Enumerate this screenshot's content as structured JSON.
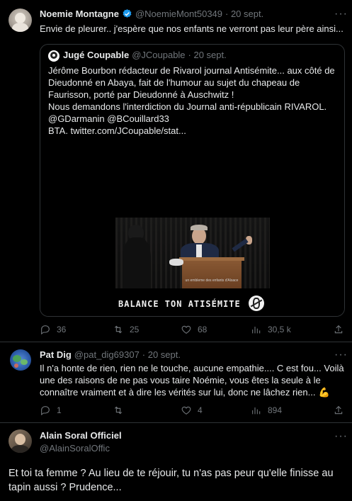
{
  "tweet1": {
    "name": "Noemie Montagne",
    "handle": "@NoemieMont50349",
    "date": "· 20 sept.",
    "text": "Envie de pleurer.. j'espère que nos enfants ne verront pas leur père ainsi...",
    "quote": {
      "name": "Jugé Coupable",
      "handle": "@JCoupable",
      "date": "· 20 sept.",
      "lines": [
        "Jérôme Bourbon rédacteur de Rivarol journal Antisémite... aux côté de",
        "Dieudonné en Abaya, fait de l'humour au sujet du chapeau de",
        "Faurisson, porté par Dieudonné à Auschwitz !",
        "Nous demandons l'interdiction du Journal anti-républicain RIVAROL.",
        "@GDarmanin @BCouillard33",
        "BTA.  twitter.com/JCoupable/stat..."
      ],
      "video_subtitle": "un embleme des enfants d'Alsace",
      "video_caption": "BALANCE TON ATISÉMITE"
    },
    "stats": {
      "replies": "36",
      "retweets": "25",
      "likes": "68",
      "views": "30,5 k"
    }
  },
  "tweet2": {
    "name": "Pat Dig",
    "handle": "@pat_dig69307",
    "date": "· 20 sept.",
    "lines": [
      "Il n'a honte de rien, rien ne le touche, aucune empathie.... C est fou... Voilà",
      "une des raisons de ne pas vous taire Noémie, vous êtes la seule à le",
      "connaître vraiment et à dire les vérités sur lui, donc ne lâchez rien..."
    ],
    "emoji": "💪",
    "stats": {
      "replies": "1",
      "retweets": "",
      "likes": "4",
      "views": "894"
    }
  },
  "tweet3": {
    "name": "Alain Soral Officiel",
    "handle": "@AlainSoralOffic",
    "lines": [
      "Et toi ta femme ? Au lieu de te réjouir, tu n'as pas peur qu'elle finisse au",
      "tapin aussi ? Prudence..."
    ]
  },
  "colors": {
    "verified": "#1d9bf0",
    "muted": "#71767b",
    "divider": "#2f3336"
  }
}
